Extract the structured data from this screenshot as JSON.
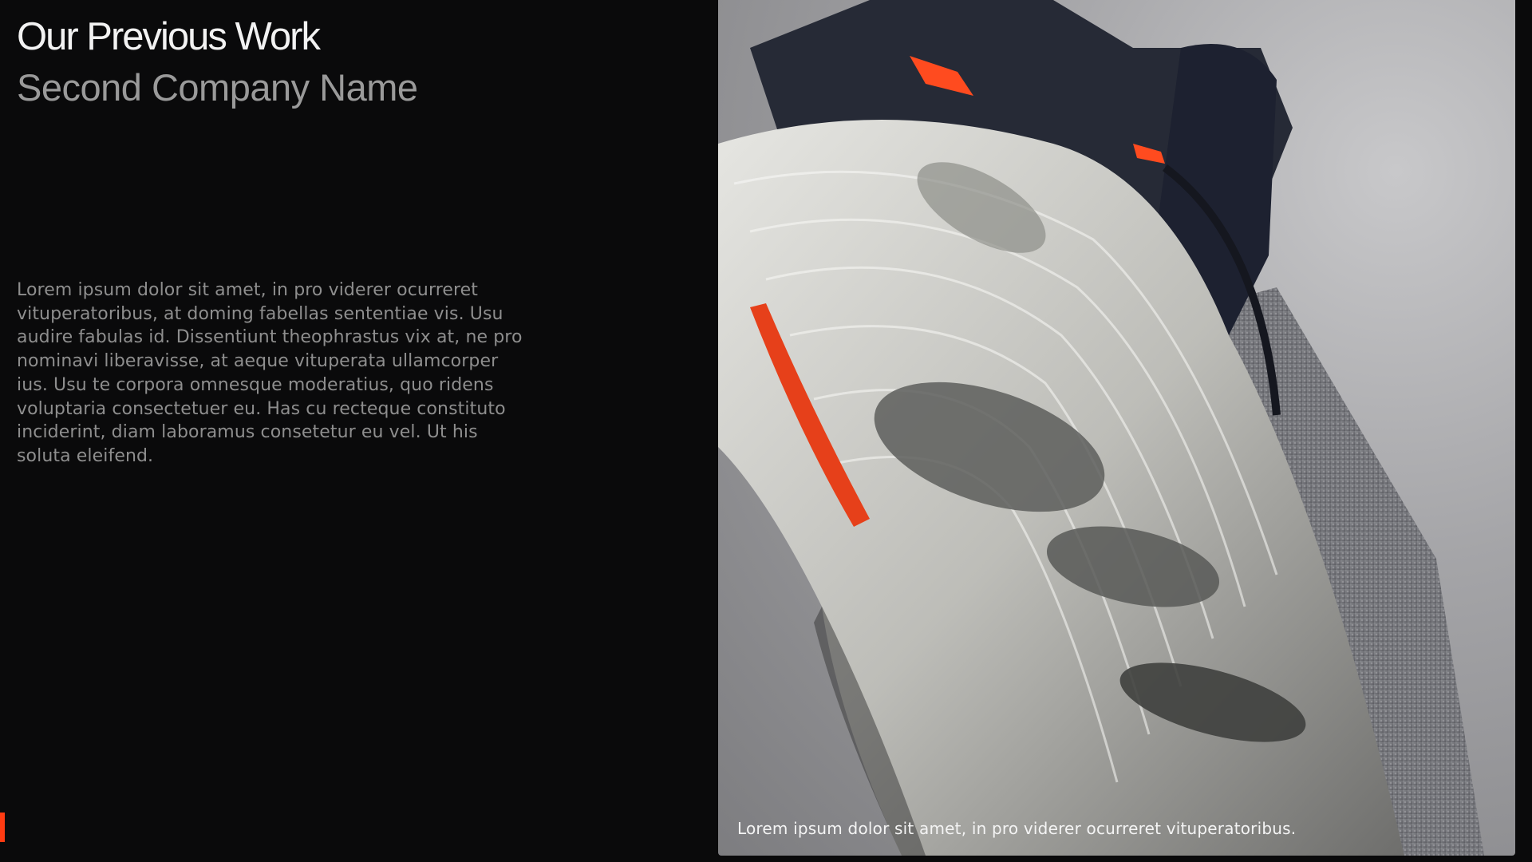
{
  "heading": {
    "title": "Our Previous Work",
    "subtitle": "Second Company Name"
  },
  "description": "Lorem ipsum dolor sit amet, in pro viderer ocurreret vituperatoribus, at doming fabellas sententiae vis. Usu audire fabulas id. Dissentiunt theophrastus vix at, ne pro nominavi liberavisse, at aeque vituperata ullamcorper ius. Usu te corpora omnesque moderatius, quo ridens voluptaria consectetuer eu. Has cu recteque constituto inciderint, diam laboramus consetetur eu vel. Ut his soluta eleifend.",
  "image": {
    "subject": "sneaker-photo",
    "caption": "Lorem ipsum dolor sit amet, in pro viderer ocurreret vituperatoribus."
  },
  "colors": {
    "background": "#0a0a0b",
    "accent": "#ff3b12",
    "title": "#f2f2f2",
    "subtitle": "#9a9a9a",
    "body": "#8e8e8e"
  }
}
